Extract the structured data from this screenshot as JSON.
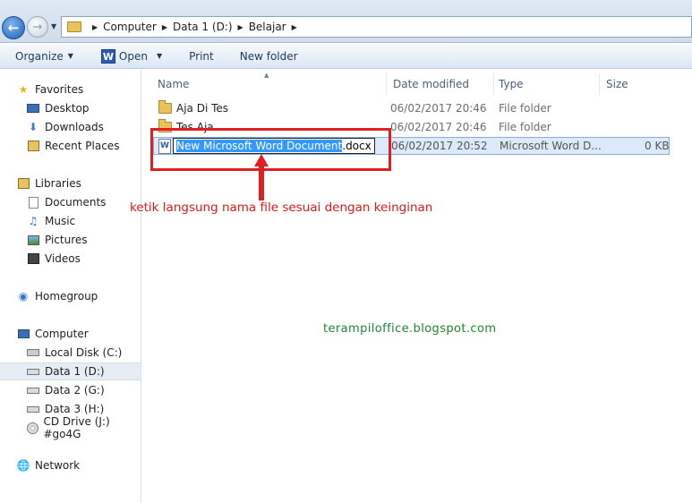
{
  "breadcrumb": [
    "Computer",
    "Data 1 (D:)",
    "Belajar"
  ],
  "toolbar": {
    "organize": "Organize",
    "open": "Open",
    "print": "Print",
    "new_folder": "New folder"
  },
  "nav": {
    "favorites": "Favorites",
    "desktop": "Desktop",
    "downloads": "Downloads",
    "recent_places": "Recent Places",
    "libraries": "Libraries",
    "documents": "Documents",
    "music": "Music",
    "pictures": "Pictures",
    "videos": "Videos",
    "homegroup": "Homegroup",
    "computer": "Computer",
    "local_disk": "Local Disk (C:)",
    "data1": "Data 1 (D:)",
    "data2": "Data 2 (G:)",
    "data3": "Data 3 (H:)",
    "cd_drive": "CD Drive (J:) #go4G",
    "network": "Network"
  },
  "columns": {
    "name": "Name",
    "date_modified": "Date modified",
    "type": "Type",
    "size": "Size"
  },
  "files": [
    {
      "name": "Aja Di Tes",
      "date": "06/02/2017 20:46",
      "type": "File folder",
      "size": ""
    },
    {
      "name": "Tes Aja",
      "date": "06/02/2017 20:46",
      "type": "File folder",
      "size": ""
    },
    {
      "name": "New Microsoft Word Document.docx",
      "date": "06/02/2017 20:52",
      "type": "Microsoft Word D...",
      "size": "0 KB"
    }
  ],
  "rename": {
    "selected_part": "New Microsoft Word Document",
    "extension": ".docx"
  },
  "annotation": "ketik langsung nama file sesuai dengan keinginan",
  "watermark": "terampiloffice.blogspot.com",
  "colors": {
    "annotation_red": "#e02020",
    "watermark_green": "#1d8a2a",
    "selection_blue": "#3399ff"
  }
}
